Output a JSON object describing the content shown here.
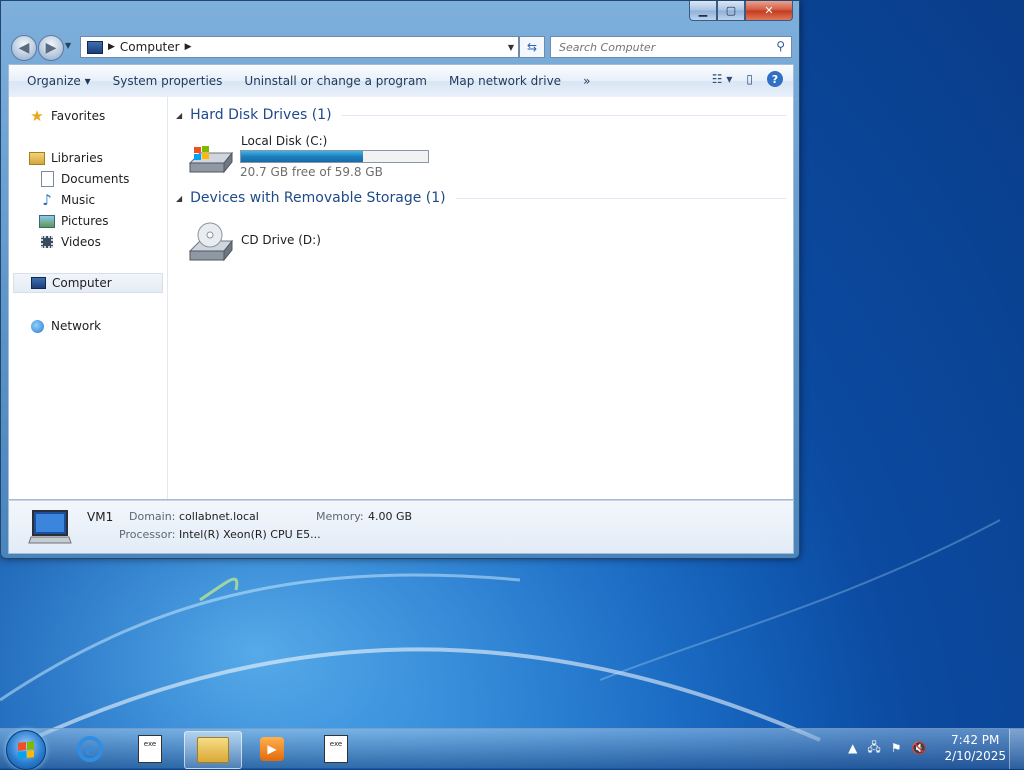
{
  "window": {
    "caption": {
      "minimize": "▁",
      "maximize": "▢",
      "close": "✕"
    },
    "address": {
      "segment": "Computer"
    },
    "search": {
      "placeholder": "Search Computer"
    },
    "toolbar": {
      "organize": "Organize ▾",
      "system_properties": "System properties",
      "uninstall": "Uninstall or change a program",
      "map_drive": "Map network drive",
      "more": "»"
    },
    "nav_pane": {
      "favorites": "Favorites",
      "libraries": "Libraries",
      "documents": "Documents",
      "music": "Music",
      "pictures": "Pictures",
      "videos": "Videos",
      "computer": "Computer",
      "network": "Network"
    },
    "groups": {
      "hdd": "Hard Disk Drives (1)",
      "removable": "Devices with Removable Storage (1)"
    },
    "drives": {
      "c": {
        "name": "Local Disk (C:)",
        "free_text": "20.7 GB free of 59.8 GB",
        "used_fraction": 0.654
      },
      "d": {
        "name": "CD Drive (D:)"
      }
    },
    "details": {
      "name": "VM1",
      "domain_label": "Domain:",
      "domain_value": "collabnet.local",
      "memory_label": "Memory:",
      "memory_value": "4.00 GB",
      "processor_label": "Processor:",
      "processor_value": "Intel(R) Xeon(R) CPU E5..."
    }
  },
  "taskbar": {
    "clock_time": "7:42 PM",
    "clock_date": "2/10/2025",
    "ie_letter": "e",
    "prog_label": "exe"
  },
  "colors": {
    "accent": "#1e4a8a",
    "bar_fill": "#1e7fc0"
  }
}
